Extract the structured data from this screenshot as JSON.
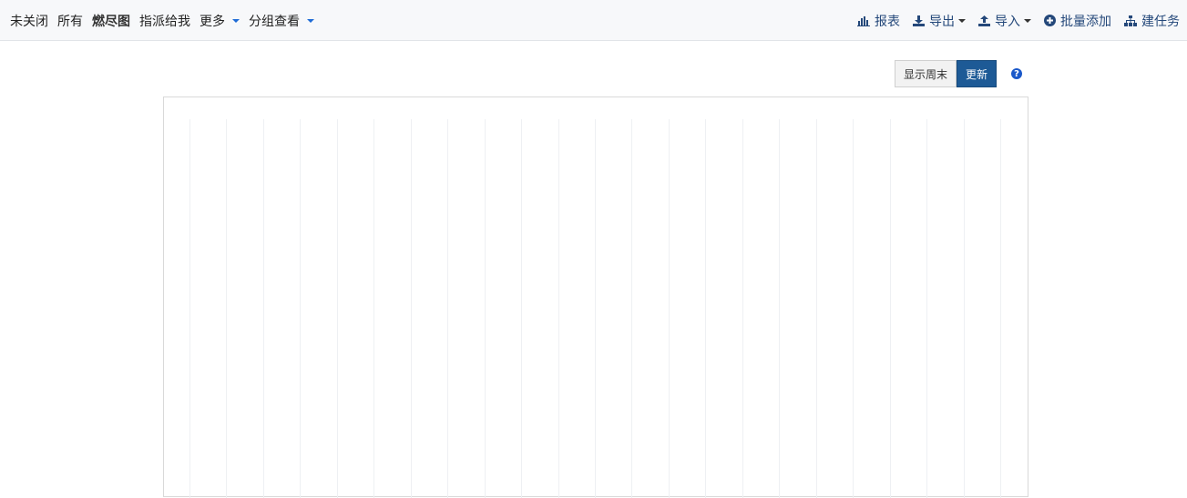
{
  "nav": {
    "items": [
      {
        "label": "未关闭",
        "active": false,
        "dropdown": false
      },
      {
        "label": "所有",
        "active": false,
        "dropdown": false
      },
      {
        "label": "燃尽图",
        "active": true,
        "dropdown": false
      },
      {
        "label": "指派给我",
        "active": false,
        "dropdown": false
      },
      {
        "label": "更多",
        "active": false,
        "dropdown": true
      },
      {
        "label": "分组查看",
        "active": false,
        "dropdown": true
      }
    ]
  },
  "actions": {
    "report": {
      "label": "报表",
      "icon": "bar-chart-icon"
    },
    "export": {
      "label": "导出",
      "icon": "download-icon"
    },
    "import": {
      "label": "导入",
      "icon": "upload-icon"
    },
    "batch_add": {
      "label": "批量添加",
      "icon": "plus-circle-icon"
    },
    "create_task": {
      "label": "建任务",
      "icon": "sitemap-icon"
    }
  },
  "controls": {
    "show_weekend_label": "显示周末",
    "update_label": "更新",
    "help_icon": "?"
  },
  "colors": {
    "accent": "#1d5a96",
    "link": "#24487a",
    "caret": "#1e6bd6",
    "help": "#1a58c9"
  },
  "chart": {
    "gridline_count": 23
  }
}
